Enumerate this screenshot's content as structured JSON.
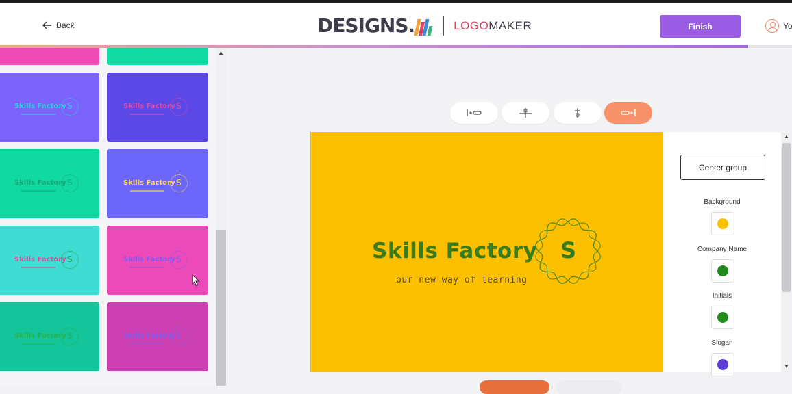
{
  "header": {
    "back_label": "Back",
    "brand_name": "DESIGNS.",
    "brand_suffix": "AI",
    "product_accent": "LOGO",
    "product_rest": "MAKER",
    "finish_label": "Finish",
    "user_label": "Yo",
    "progress_fraction": 0.945
  },
  "templates": [
    {
      "bg": "#ee4bb6",
      "name_color": "#ffffff",
      "init_color": "#ffffff",
      "partial": true
    },
    {
      "bg": "#12dba3",
      "name_color": "#ffffff",
      "init_color": "#ffffff",
      "partial": true
    },
    {
      "bg": "#7b63fb",
      "name_color": "#27d6e0",
      "init_color": "#27d6e0"
    },
    {
      "bg": "#5b48e6",
      "name_color": "#e64aa7",
      "init_color": "#e64aa7"
    },
    {
      "bg": "#0fd9a0",
      "name_color": "#1ea57c",
      "init_color": "#1ea57c"
    },
    {
      "bg": "#6d66fa",
      "name_color": "#ffd84a",
      "init_color": "#ffd84a"
    },
    {
      "bg": "#3fdcd4",
      "name_color": "#e04a98",
      "init_color": "#2a9c42"
    },
    {
      "bg": "#ec49b9",
      "name_color": "#7e5cf3",
      "init_color": "#7e5cf3"
    },
    {
      "bg": "#14c49a",
      "name_color": "#2ab048",
      "init_color": "#2ab048"
    },
    {
      "bg": "#cc3fb1",
      "name_color": "#7a5cf0",
      "init_color": "#7a5cf0"
    }
  ],
  "template_text": {
    "name": "Skills Factory",
    "initial": "S"
  },
  "align_buttons": [
    {
      "name": "align-left",
      "active": false
    },
    {
      "name": "align-center-vertical",
      "active": false
    },
    {
      "name": "align-center-horizontal",
      "active": false
    },
    {
      "name": "align-right",
      "active": true
    }
  ],
  "canvas": {
    "background": "#fcc000",
    "company_name": "Skills Factory",
    "initials": "S",
    "slogan": "our new way of learning"
  },
  "panel": {
    "center_group_label": "Center group",
    "colors": [
      {
        "label": "Background",
        "color": "#fcc000"
      },
      {
        "label": "Company Name",
        "color": "#238a1e"
      },
      {
        "label": "Initials",
        "color": "#238a1e"
      },
      {
        "label": "Slogan",
        "color": "#5b3cd6"
      }
    ]
  }
}
